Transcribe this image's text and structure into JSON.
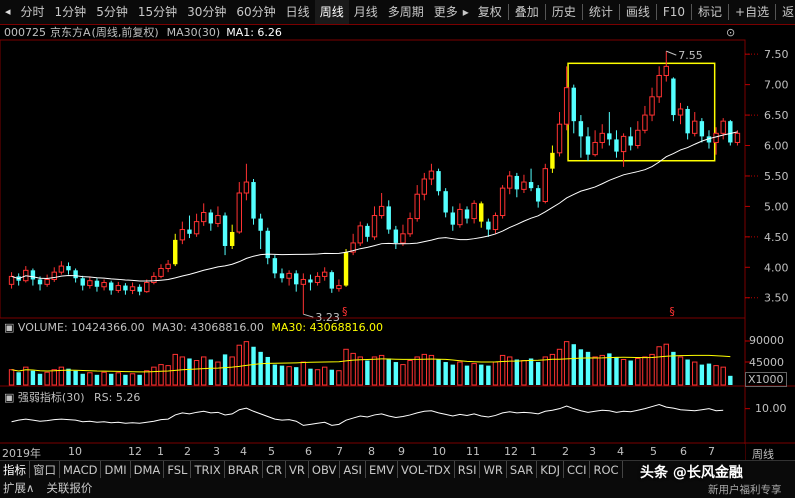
{
  "toolbar": {
    "periods": [
      "分时",
      "1分钟",
      "5分钟",
      "15分钟",
      "30分钟",
      "60分钟",
      "日线",
      "周线",
      "月线",
      "多周期",
      "更多"
    ],
    "active": "周线",
    "more_arrow": "▸",
    "actions": [
      "复权",
      "叠加",
      "历史",
      "统计",
      "画线",
      "F10",
      "标记",
      "+自选",
      "返回"
    ]
  },
  "title": {
    "code": "000725",
    "name": "京东方A",
    "mode": "(周线,前复权)",
    "ma_label": "MA30(30)",
    "ma_value": "MA1: 6.26"
  },
  "price_axis": {
    "ticks": [
      "7.50",
      "7.00",
      "6.50",
      "6.00",
      "5.50",
      "5.00",
      "4.50",
      "4.00",
      "3.50"
    ]
  },
  "annotations": {
    "high": "7.55",
    "low": "3.23",
    "marker": "§"
  },
  "volume": {
    "label": "VOLUME: 10424366.00",
    "ma30": "MA30: 43068816.00",
    "ma30b": "MA30: 43068816.00",
    "ticks": [
      "90000",
      "45000"
    ],
    "unit": "X1000"
  },
  "rs": {
    "label": "强弱指标(30)",
    "value": "RS: 5.26",
    "tick": "10.00"
  },
  "xaxis": {
    "labels": [
      "2019年",
      "10",
      "12",
      "1",
      "2",
      "3",
      "4",
      "5",
      "6",
      "7",
      "8",
      "9",
      "10",
      "11",
      "12",
      "1",
      "2",
      "3",
      "4",
      "5",
      "6",
      "7"
    ],
    "period_button": "周线"
  },
  "indicators": [
    "指标",
    "窗口",
    "MACD",
    "DMI",
    "DMA",
    "FSL",
    "TRIX",
    "BRAR",
    "CR",
    "VR",
    "OBV",
    "ASI",
    "EMV",
    "VOL-TDX",
    "RSI",
    "WR",
    "SAR",
    "KDJ",
    "CCI",
    "ROC"
  ],
  "footer": {
    "expand": "扩展∧",
    "quote": "关联报价",
    "watermark": "头条 @长风金融",
    "watermark2": "新用户福利专享"
  },
  "chart_data": {
    "type": "candlestick",
    "y_range": [
      3.2,
      7.7
    ],
    "candles": [
      {
        "o": 3.72,
        "c": 3.85,
        "h": 3.92,
        "l": 3.65
      },
      {
        "o": 3.85,
        "c": 3.78,
        "h": 3.9,
        "l": 3.7
      },
      {
        "o": 3.78,
        "c": 3.95,
        "h": 4.02,
        "l": 3.75
      },
      {
        "o": 3.95,
        "c": 3.8,
        "h": 3.98,
        "l": 3.7
      },
      {
        "o": 3.8,
        "c": 3.72,
        "h": 3.85,
        "l": 3.62
      },
      {
        "o": 3.72,
        "c": 3.8,
        "h": 3.88,
        "l": 3.68
      },
      {
        "o": 3.8,
        "c": 3.92,
        "h": 4.0,
        "l": 3.76
      },
      {
        "o": 3.92,
        "c": 4.02,
        "h": 4.1,
        "l": 3.88
      },
      {
        "o": 4.02,
        "c": 3.95,
        "h": 4.08,
        "l": 3.88
      },
      {
        "o": 3.95,
        "c": 3.82,
        "h": 3.98,
        "l": 3.75
      },
      {
        "o": 3.82,
        "c": 3.7,
        "h": 3.86,
        "l": 3.62
      },
      {
        "o": 3.7,
        "c": 3.78,
        "h": 3.85,
        "l": 3.65
      },
      {
        "o": 3.78,
        "c": 3.68,
        "h": 3.82,
        "l": 3.6
      },
      {
        "o": 3.68,
        "c": 3.75,
        "h": 3.8,
        "l": 3.62
      },
      {
        "o": 3.75,
        "c": 3.62,
        "h": 3.78,
        "l": 3.55
      },
      {
        "o": 3.62,
        "c": 3.7,
        "h": 3.76,
        "l": 3.58
      },
      {
        "o": 3.7,
        "c": 3.62,
        "h": 3.74,
        "l": 3.55
      },
      {
        "o": 3.62,
        "c": 3.68,
        "h": 3.75,
        "l": 3.56
      },
      {
        "o": 3.68,
        "c": 3.6,
        "h": 3.72,
        "l": 3.54
      },
      {
        "o": 3.6,
        "c": 3.75,
        "h": 3.8,
        "l": 3.58
      },
      {
        "o": 3.75,
        "c": 3.85,
        "h": 3.92,
        "l": 3.72
      },
      {
        "o": 3.85,
        "c": 3.98,
        "h": 4.05,
        "l": 3.82
      },
      {
        "o": 3.98,
        "c": 4.05,
        "h": 4.12,
        "l": 3.92
      },
      {
        "o": 4.05,
        "c": 4.45,
        "h": 4.55,
        "l": 4.02
      },
      {
        "o": 4.45,
        "c": 4.62,
        "h": 4.75,
        "l": 4.38
      },
      {
        "o": 4.62,
        "c": 4.55,
        "h": 4.85,
        "l": 4.48
      },
      {
        "o": 4.55,
        "c": 4.75,
        "h": 4.88,
        "l": 4.5
      },
      {
        "o": 4.75,
        "c": 4.9,
        "h": 5.05,
        "l": 4.68
      },
      {
        "o": 4.9,
        "c": 4.72,
        "h": 4.95,
        "l": 4.6
      },
      {
        "o": 4.72,
        "c": 4.85,
        "h": 5.0,
        "l": 4.66
      },
      {
        "o": 4.85,
        "c": 4.35,
        "h": 4.9,
        "l": 4.2
      },
      {
        "o": 4.35,
        "c": 4.58,
        "h": 4.7,
        "l": 4.3
      },
      {
        "o": 4.58,
        "c": 5.22,
        "h": 5.4,
        "l": 4.55
      },
      {
        "o": 5.22,
        "c": 5.4,
        "h": 5.7,
        "l": 5.1
      },
      {
        "o": 5.4,
        "c": 4.8,
        "h": 5.45,
        "l": 4.7
      },
      {
        "o": 4.8,
        "c": 4.6,
        "h": 4.88,
        "l": 4.3
      },
      {
        "o": 4.6,
        "c": 4.15,
        "h": 4.65,
        "l": 4.05
      },
      {
        "o": 4.15,
        "c": 3.9,
        "h": 4.2,
        "l": 3.82
      },
      {
        "o": 3.9,
        "c": 3.82,
        "h": 3.98,
        "l": 3.75
      },
      {
        "o": 3.82,
        "c": 3.9,
        "h": 3.95,
        "l": 3.7
      },
      {
        "o": 3.9,
        "c": 3.72,
        "h": 3.95,
        "l": 3.6
      },
      {
        "o": 3.72,
        "c": 3.8,
        "h": 3.9,
        "l": 3.23
      },
      {
        "o": 3.8,
        "c": 3.75,
        "h": 3.88,
        "l": 3.62
      },
      {
        "o": 3.75,
        "c": 3.85,
        "h": 3.92,
        "l": 3.7
      },
      {
        "o": 3.85,
        "c": 3.92,
        "h": 4.0,
        "l": 3.78
      },
      {
        "o": 3.92,
        "c": 3.65,
        "h": 3.95,
        "l": 3.58
      },
      {
        "o": 3.65,
        "c": 3.7,
        "h": 3.8,
        "l": 3.6
      },
      {
        "o": 3.7,
        "c": 4.25,
        "h": 4.3,
        "l": 3.68
      },
      {
        "o": 4.25,
        "c": 4.4,
        "h": 4.55,
        "l": 4.2
      },
      {
        "o": 4.4,
        "c": 4.68,
        "h": 4.75,
        "l": 4.35
      },
      {
        "o": 4.68,
        "c": 4.5,
        "h": 4.72,
        "l": 4.42
      },
      {
        "o": 4.5,
        "c": 4.85,
        "h": 5.0,
        "l": 4.45
      },
      {
        "o": 4.85,
        "c": 5.0,
        "h": 5.22,
        "l": 4.8
      },
      {
        "o": 5.0,
        "c": 4.62,
        "h": 5.1,
        "l": 4.55
      },
      {
        "o": 4.62,
        "c": 4.4,
        "h": 4.68,
        "l": 4.3
      },
      {
        "o": 4.4,
        "c": 4.55,
        "h": 4.7,
        "l": 4.35
      },
      {
        "o": 4.55,
        "c": 4.8,
        "h": 4.9,
        "l": 4.5
      },
      {
        "o": 4.8,
        "c": 5.2,
        "h": 5.35,
        "l": 4.75
      },
      {
        "o": 5.2,
        "c": 5.45,
        "h": 5.55,
        "l": 5.1
      },
      {
        "o": 5.45,
        "c": 5.58,
        "h": 5.7,
        "l": 5.35
      },
      {
        "o": 5.58,
        "c": 5.25,
        "h": 5.62,
        "l": 5.18
      },
      {
        "o": 5.25,
        "c": 4.9,
        "h": 5.3,
        "l": 4.82
      },
      {
        "o": 4.9,
        "c": 4.7,
        "h": 5.0,
        "l": 4.6
      },
      {
        "o": 4.7,
        "c": 4.95,
        "h": 5.05,
        "l": 4.65
      },
      {
        "o": 4.95,
        "c": 4.8,
        "h": 5.0,
        "l": 4.72
      },
      {
        "o": 4.8,
        "c": 5.05,
        "h": 5.1,
        "l": 4.72
      },
      {
        "o": 5.05,
        "c": 4.75,
        "h": 5.08,
        "l": 4.65
      },
      {
        "o": 4.75,
        "c": 4.62,
        "h": 4.8,
        "l": 4.5
      },
      {
        "o": 4.62,
        "c": 4.85,
        "h": 4.9,
        "l": 4.55
      },
      {
        "o": 4.85,
        "c": 5.3,
        "h": 5.35,
        "l": 4.8
      },
      {
        "o": 5.3,
        "c": 5.5,
        "h": 5.58,
        "l": 5.2
      },
      {
        "o": 5.5,
        "c": 5.28,
        "h": 5.55,
        "l": 5.15
      },
      {
        "o": 5.28,
        "c": 5.4,
        "h": 5.52,
        "l": 5.22
      },
      {
        "o": 5.4,
        "c": 5.3,
        "h": 5.62,
        "l": 5.25
      },
      {
        "o": 5.3,
        "c": 5.08,
        "h": 5.35,
        "l": 4.98
      },
      {
        "o": 5.08,
        "c": 5.62,
        "h": 5.7,
        "l": 5.05
      },
      {
        "o": 5.62,
        "c": 5.88,
        "h": 6.0,
        "l": 5.55
      },
      {
        "o": 5.88,
        "c": 6.35,
        "h": 6.55,
        "l": 5.82
      },
      {
        "o": 6.35,
        "c": 6.95,
        "h": 7.3,
        "l": 6.25
      },
      {
        "o": 6.95,
        "c": 6.4,
        "h": 7.0,
        "l": 6.2
      },
      {
        "o": 6.4,
        "c": 6.15,
        "h": 6.5,
        "l": 5.8
      },
      {
        "o": 6.15,
        "c": 5.85,
        "h": 6.3,
        "l": 5.75
      },
      {
        "o": 5.85,
        "c": 6.05,
        "h": 6.25,
        "l": 5.82
      },
      {
        "o": 6.05,
        "c": 6.2,
        "h": 6.35,
        "l": 5.95
      },
      {
        "o": 6.2,
        "c": 6.1,
        "h": 6.55,
        "l": 6.0
      },
      {
        "o": 6.1,
        "c": 5.9,
        "h": 6.25,
        "l": 5.8
      },
      {
        "o": 5.9,
        "c": 6.15,
        "h": 6.2,
        "l": 5.65
      },
      {
        "o": 6.15,
        "c": 6.0,
        "h": 6.3,
        "l": 5.92
      },
      {
        "o": 6.0,
        "c": 6.25,
        "h": 6.4,
        "l": 5.95
      },
      {
        "o": 6.25,
        "c": 6.5,
        "h": 6.65,
        "l": 6.2
      },
      {
        "o": 6.5,
        "c": 6.8,
        "h": 6.95,
        "l": 6.4
      },
      {
        "o": 6.8,
        "c": 7.15,
        "h": 7.3,
        "l": 6.7
      },
      {
        "o": 7.15,
        "c": 7.3,
        "h": 7.55,
        "l": 7.05
      },
      {
        "o": 7.1,
        "c": 6.5,
        "h": 7.12,
        "l": 6.4
      },
      {
        "o": 6.5,
        "c": 6.6,
        "h": 6.7,
        "l": 6.35
      },
      {
        "o": 6.6,
        "c": 6.2,
        "h": 6.65,
        "l": 6.1
      },
      {
        "o": 6.2,
        "c": 6.4,
        "h": 6.55,
        "l": 6.15
      },
      {
        "o": 6.4,
        "c": 6.15,
        "h": 6.45,
        "l": 6.05
      },
      {
        "o": 6.15,
        "c": 6.05,
        "h": 6.25,
        "l": 5.95
      },
      {
        "o": 6.05,
        "c": 6.2,
        "h": 6.3,
        "l": 5.85
      },
      {
        "o": 6.2,
        "c": 6.4,
        "h": 6.45,
        "l": 6.1
      },
      {
        "o": 6.4,
        "c": 6.05,
        "h": 6.42,
        "l": 6.0
      },
      {
        "o": 6.05,
        "c": 6.2,
        "h": 6.25,
        "l": 6.0
      }
    ],
    "highlight_box": {
      "start": 79,
      "end": 98,
      "low": 5.75,
      "high": 7.35
    },
    "special_yellow": [
      23,
      31,
      47,
      66,
      76
    ],
    "volume": [
      30,
      25,
      35,
      28,
      22,
      25,
      30,
      35,
      32,
      28,
      22,
      24,
      20,
      25,
      22,
      24,
      20,
      22,
      20,
      28,
      35,
      40,
      38,
      60,
      55,
      52,
      48,
      55,
      50,
      45,
      60,
      55,
      78,
      85,
      75,
      65,
      55,
      40,
      38,
      36,
      35,
      45,
      32,
      30,
      35,
      30,
      28,
      70,
      62,
      55,
      48,
      55,
      58,
      52,
      45,
      40,
      48,
      55,
      60,
      58,
      50,
      45,
      40,
      45,
      38,
      42,
      40,
      38,
      45,
      58,
      55,
      50,
      48,
      52,
      45,
      55,
      60,
      70,
      85,
      80,
      70,
      65,
      55,
      58,
      62,
      55,
      50,
      48,
      52,
      55,
      60,
      75,
      80,
      65,
      55,
      50,
      45,
      40,
      42,
      38,
      35,
      18
    ],
    "volume_range": [
      0,
      100
    ],
    "rs": [
      7.5,
      7.8,
      8.0,
      7.8,
      7.6,
      7.7,
      7.9,
      8.0,
      7.9,
      7.8,
      7.5,
      7.6,
      7.4,
      7.5,
      7.3,
      7.4,
      7.2,
      7.3,
      7.2,
      7.4,
      7.6,
      7.9,
      8.0,
      8.8,
      9.2,
      9.0,
      9.3,
      9.5,
      9.2,
      9.3,
      8.8,
      9.0,
      9.8,
      10.1,
      9.5,
      9.0,
      8.5,
      8.0,
      7.8,
      7.9,
      7.6,
      6.8,
      7.0,
      7.2,
      7.4,
      6.8,
      7.0,
      7.8,
      8.2,
      8.6,
      8.4,
      8.8,
      9.0,
      8.6,
      8.3,
      8.5,
      8.8,
      9.2,
      9.5,
      9.6,
      9.2,
      8.9,
      8.6,
      8.9,
      8.7,
      9.0,
      8.6,
      8.4,
      8.7,
      9.2,
      9.4,
      9.2,
      9.3,
      9.2,
      9.0,
      9.5,
      9.7,
      10.0,
      10.5,
      10.0,
      9.6,
      9.3,
      9.5,
      9.7,
      9.6,
      9.3,
      9.5,
      9.4,
      9.7,
      10.0,
      10.4,
      10.8,
      10.3,
      10.1,
      9.8,
      9.7,
      9.6,
      9.8,
      10.0,
      9.6,
      9.7
    ],
    "rs_range": [
      4,
      13
    ]
  }
}
